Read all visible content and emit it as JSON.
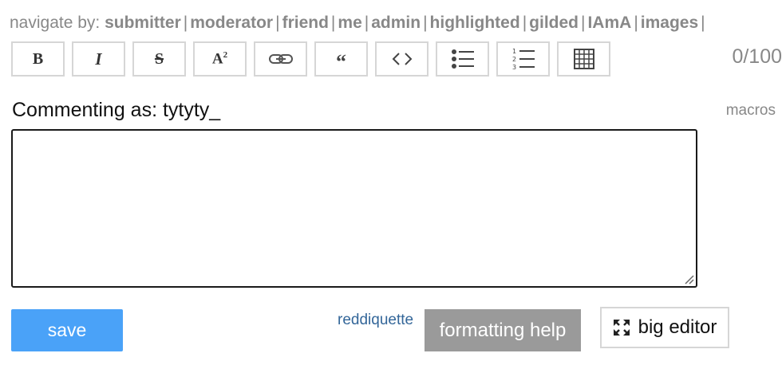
{
  "nav": {
    "label": "navigate by:",
    "links": [
      "submitter",
      "moderator",
      "friend",
      "me",
      "admin",
      "highlighted",
      "gilded",
      "IAmA",
      "images"
    ],
    "trailing": "|"
  },
  "toolbar": {
    "bold": "B",
    "italic": "I",
    "strike": "S",
    "superscript": "A",
    "superscript_small": "2",
    "quote": "“",
    "icons": [
      "bold-icon",
      "italic-icon",
      "strikethrough-icon",
      "superscript-icon",
      "link-icon",
      "quote-icon",
      "code-icon",
      "bulleted-list-icon",
      "numbered-list-icon",
      "table-icon"
    ]
  },
  "counter": "0/100",
  "commenting": "Commenting as: tytyty_",
  "macros": "macros",
  "textarea": {
    "value": ""
  },
  "buttons": {
    "save": "save",
    "reddiquette": "reddiquette",
    "formatting_help": "formatting help",
    "big_editor": "big editor"
  },
  "colors": {
    "save_bg": "#4aa2f8",
    "formatting_bg": "#9a9a9a",
    "link": "#336699",
    "muted": "#888888"
  }
}
